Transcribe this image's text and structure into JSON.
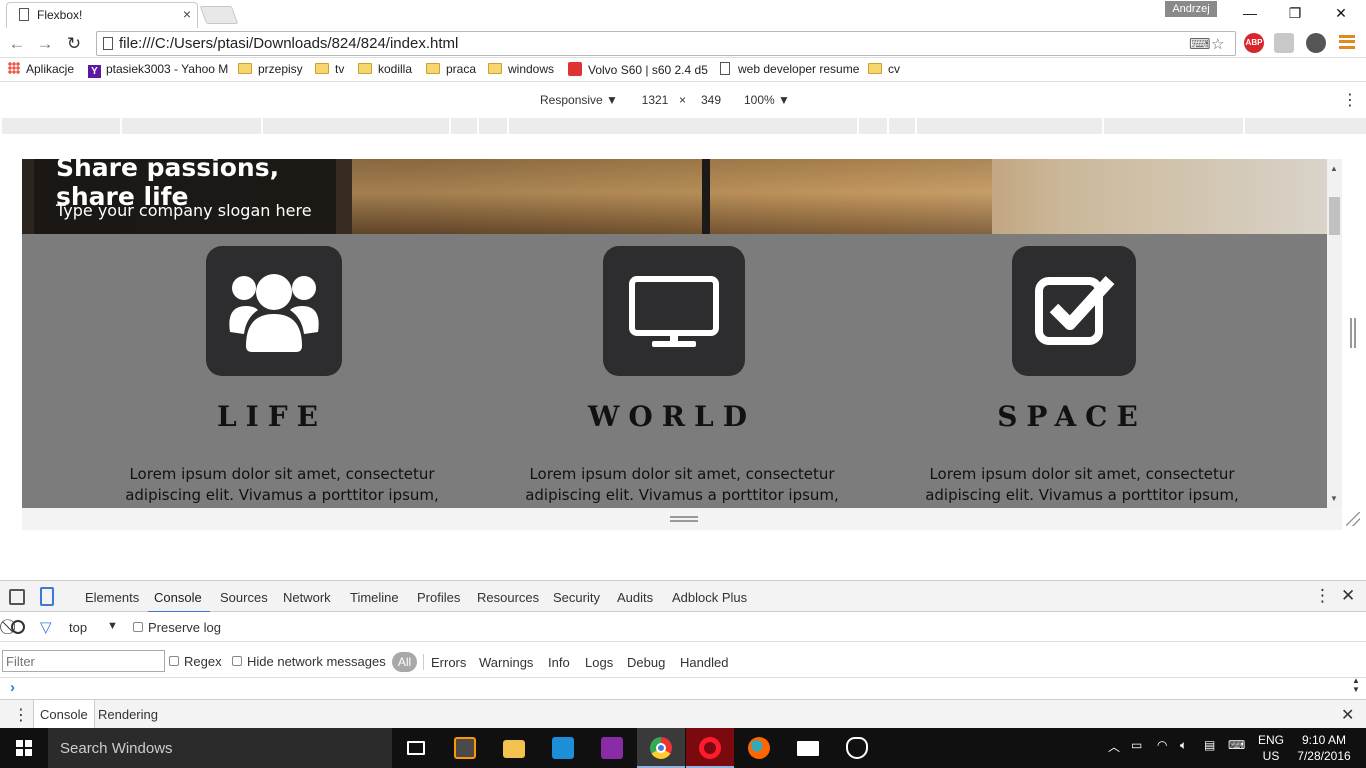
{
  "window": {
    "tab_title": "Flexbox!",
    "user_name": "Andrzej",
    "minimize": "—",
    "restore": "❐",
    "close": "✕"
  },
  "toolbar": {
    "url": "file:///C:/Users/ptasi/Downloads/824/824/index.html",
    "back": "←",
    "forward": "→",
    "reload": "↻",
    "abp_label": "ABP"
  },
  "bookmarks": {
    "items": [
      "Aplikacje",
      "ptasiek3003 - Yahoo M",
      "przepisy",
      "tv",
      "kodilla",
      "praca",
      "windows",
      "Volvo S60 | s60 2.4 d5",
      "web developer resume",
      "cv"
    ]
  },
  "device": {
    "mode": "Responsive ▼",
    "width": "1321",
    "times": "×",
    "height": "349",
    "zoom": "100% ▼"
  },
  "page": {
    "hero_title": "Share passions, share life",
    "hero_slogan": "Type your company slogan here",
    "features": [
      {
        "title": "LIFE",
        "text": "Lorem ipsum dolor sit amet, consectetur adipiscing elit. Vivamus a porttitor ipsum, ut"
      },
      {
        "title": "WORLD",
        "text": "Lorem ipsum dolor sit amet, consectetur adipiscing elit. Vivamus a porttitor ipsum, ut"
      },
      {
        "title": "SPACE",
        "text": "Lorem ipsum dolor sit amet, consectetur adipiscing elit. Vivamus a porttitor ipsum, ut"
      }
    ]
  },
  "devtools": {
    "tabs": [
      "Elements",
      "Console",
      "Sources",
      "Network",
      "Timeline",
      "Profiles",
      "Resources",
      "Security",
      "Audits",
      "Adblock Plus"
    ],
    "active_tab": "Console",
    "context": "top",
    "preserve_log": "Preserve log",
    "filter_placeholder": "Filter",
    "regex": "Regex",
    "hide_network": "Hide network messages",
    "levels": [
      "All",
      "Errors",
      "Warnings",
      "Info",
      "Logs",
      "Debug",
      "Handled"
    ],
    "prompt": "›",
    "drawer_tabs": [
      "Console",
      "Rendering"
    ]
  },
  "taskbar": {
    "search_placeholder": "Search Windows",
    "lang_top": "ENG",
    "lang_bottom": "US",
    "time": "9:10 AM",
    "date": "7/28/2016"
  },
  "colors": {
    "content_bg": "#7c7c7c",
    "icon_tile": "#2d2d2f",
    "devtools_accent": "#3879d9",
    "abp": "#d9262b",
    "opera": "#cc0f16"
  }
}
